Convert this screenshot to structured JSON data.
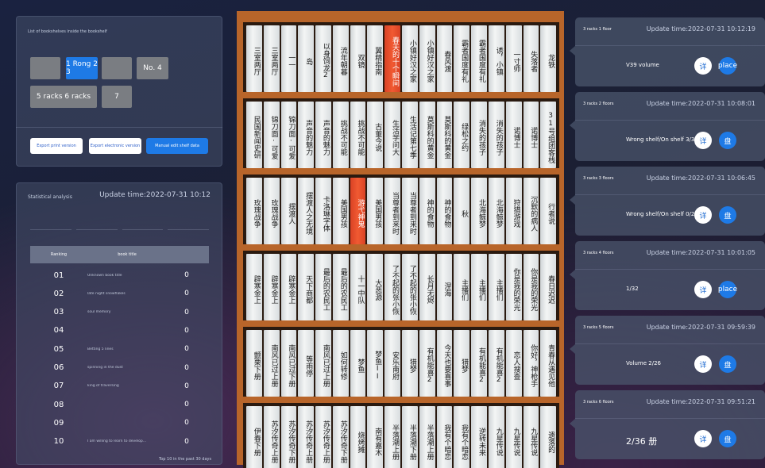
{
  "left_top": {
    "header_text": "List of bookshelves inside the bookshelf",
    "rack_buttons": [
      "",
      "1 Rong 2 3",
      "",
      "No. 4",
      "5 racks 6 racks",
      "7"
    ],
    "export_buttons": [
      "Export print version",
      "Export electronic version",
      "Manual edit shelf data"
    ]
  },
  "stats": {
    "title": "Statistical analysis",
    "update": "Update time:2022-07-31 10:12",
    "filters": [
      "",
      "",
      "",
      ""
    ],
    "columns": [
      "Ranking",
      "book title",
      ""
    ],
    "rows": [
      {
        "rank": "01",
        "title": "Unknown book title",
        "val": "0"
      },
      {
        "rank": "02",
        "title": "late night snowflakes",
        "val": "0"
      },
      {
        "rank": "03",
        "title": "soul memory",
        "val": "0"
      },
      {
        "rank": "04",
        "title": "",
        "val": "0"
      },
      {
        "rank": "05",
        "title": "Betting 5 lines",
        "val": "0"
      },
      {
        "rank": "06",
        "title": "spinning in the dust",
        "val": "0"
      },
      {
        "rank": "07",
        "title": "king of traversing",
        "val": "0"
      },
      {
        "rank": "08",
        "title": "",
        "val": "0"
      },
      {
        "rank": "09",
        "title": "",
        "val": "0"
      },
      {
        "rank": "10",
        "title": "I am willing to learn to develop...",
        "val": "0"
      }
    ],
    "footer": "Top 10 in the past 30 days"
  },
  "shelves": [
    {
      "books": [
        {
          "t": "三室两厅"
        },
        {
          "t": "三室两厅"
        },
        {
          "t": "一一"
        },
        {
          "t": "岛"
        },
        {
          "t": "以身饲龙2"
        },
        {
          "t": "流年朝暮"
        },
        {
          "t": "双镜"
        },
        {
          "t": "翼精指南"
        },
        {
          "t": "春天的十个瞬间",
          "hl": true
        },
        {
          "t": "小镇好汉之家"
        },
        {
          "t": "小镇好汉之家"
        },
        {
          "t": "春风渡"
        },
        {
          "t": "霸者国度有礼"
        },
        {
          "t": "霸者国度有礼"
        },
        {
          "t": "诱，小镇"
        },
        {
          "t": "一寸师"
        },
        {
          "t": "失落者"
        },
        {
          "t": "龙铁"
        }
      ]
    },
    {
      "books": [
        {
          "t": "民国新闻史研"
        },
        {
          "t": "锦刀面·可爱"
        },
        {
          "t": "锦刀面·可爱"
        },
        {
          "t": "声音的魅力"
        },
        {
          "t": "声音的魅力"
        },
        {
          "t": "挑战不可能"
        },
        {
          "t": "挑战不可能"
        },
        {
          "t": "古董今说"
        },
        {
          "t": "生活学问大"
        },
        {
          "t": "生活记第七季"
        },
        {
          "t": "莫斯科的黄金"
        },
        {
          "t": "莫斯科的黄金"
        },
        {
          "t": "绿松之约"
        },
        {
          "t": "消失的孩子"
        },
        {
          "t": "消失的孩子"
        },
        {
          "t": "诺博士"
        },
        {
          "t": "诺博士"
        },
        {
          "t": "31号组团客栈"
        }
      ]
    },
    {
      "books": [
        {
          "t": "玫瑰战争"
        },
        {
          "t": "玫瑰战争"
        },
        {
          "t": "摆渡人"
        },
        {
          "t": "摆渡人之无境"
        },
        {
          "t": "卡洛琳字体"
        },
        {
          "t": "美国男孩"
        },
        {
          "t": "游弋神鬼",
          "hl": true
        },
        {
          "t": "美国男孩"
        },
        {
          "t": "当尊者到来时"
        },
        {
          "t": "当尊者到来时"
        },
        {
          "t": "神的食物"
        },
        {
          "t": "神的食物"
        },
        {
          "t": "秋"
        },
        {
          "t": "北海鲸梦"
        },
        {
          "t": "北海鲸梦"
        },
        {
          "t": "狩猎游戏"
        },
        {
          "t": "沉默的病人"
        },
        {
          "t": "行者说"
        }
      ]
    },
    {
      "books": [
        {
          "t": "辟寒金上"
        },
        {
          "t": "辟寒金上"
        },
        {
          "t": "辟寒金上"
        },
        {
          "t": "天下商都"
        },
        {
          "t": "最后的农民工"
        },
        {
          "t": "最后的农民工"
        },
        {
          "t": "十一中队"
        },
        {
          "t": "大恶源"
        },
        {
          "t": "了不起的张小恢"
        },
        {
          "t": "了不起的张小恢"
        },
        {
          "t": "长月无烬"
        },
        {
          "t": "涅海"
        },
        {
          "t": "主播们"
        },
        {
          "t": "主播们"
        },
        {
          "t": "主播们"
        },
        {
          "t": "你是我的荣光"
        },
        {
          "t": "你是我的荣光"
        },
        {
          "t": "春日迟迟"
        }
      ]
    },
    {
      "books": [
        {
          "t": "颤栗下册"
        },
        {
          "t": "南风已过上册"
        },
        {
          "t": "南风已过下册"
        },
        {
          "t": "等雨停"
        },
        {
          "t": "南风已过上册"
        },
        {
          "t": "如何转修"
        },
        {
          "t": "梦鱼"
        },
        {
          "t": "梦鱼II"
        },
        {
          "t": "安乐南府"
        },
        {
          "t": "猎梦"
        },
        {
          "t": "有机能喜2"
        },
        {
          "t": "今天也要喜事"
        },
        {
          "t": "猎梦"
        },
        {
          "t": "有机能喜2"
        },
        {
          "t": "有机能喜2"
        },
        {
          "t": "恋人搜查"
        },
        {
          "t": "你好，神枪手"
        },
        {
          "t": "青春从遇见他"
        }
      ]
    },
    {
      "books": [
        {
          "t": "伊春下册"
        },
        {
          "t": "苏汐传奇上册"
        },
        {
          "t": "苏汐传奇下册"
        },
        {
          "t": "苏汐传奇上册"
        },
        {
          "t": "苏汐传奇上册"
        },
        {
          "t": "苏汐传奇下册"
        },
        {
          "t": "烧烤摊"
        },
        {
          "t": "南有嘉木"
        },
        {
          "t": "半落潮上册"
        },
        {
          "t": "半落潮下册"
        },
        {
          "t": "半落潮上册"
        },
        {
          "t": "我有个暗恋"
        },
        {
          "t": "我有个暗恋"
        },
        {
          "t": "逆转未来"
        },
        {
          "t": "九星传说"
        },
        {
          "t": "九星传说"
        },
        {
          "t": "九星传说"
        },
        {
          "t": "遗落的"
        }
      ]
    }
  ],
  "cards": [
    {
      "rack": "3 racks 1 floor",
      "update": "Update time:2022-07-31 10:12:19",
      "sub": "",
      "main": "V39 volume",
      "btn1": "详",
      "btn2": "place"
    },
    {
      "rack": "3 racks 2 floors",
      "update": "Update time:2022-07-31 10:08:01",
      "sub": "",
      "main": "Wrong shelf/On shelf 3/37",
      "btn1": "详",
      "btn2": "盘"
    },
    {
      "rack": "3 racks 3 floors",
      "update": "Update time:2022-07-31 10:06:45",
      "sub": "",
      "main": "Wrong shelf/On shelf 0/25",
      "btn1": "详",
      "btn2": "盘"
    },
    {
      "rack": "3 racks 4 floors",
      "update": "Update time:2022-07-31 10:01:05",
      "sub": "",
      "main": "1/32",
      "btn1": "详",
      "btn2": "place"
    },
    {
      "rack": "3 racks 5 floors",
      "update": "Update time:2022-07-31 09:59:39",
      "sub": "",
      "main": "Volume 2/26",
      "btn1": "详",
      "btn2": "盘"
    },
    {
      "rack": "3 racks 6 floors",
      "update": "Update time:2022-07-31 09:51:21",
      "sub": "",
      "main": "2/36 册",
      "btn1": "详",
      "btn2": "盘"
    }
  ]
}
